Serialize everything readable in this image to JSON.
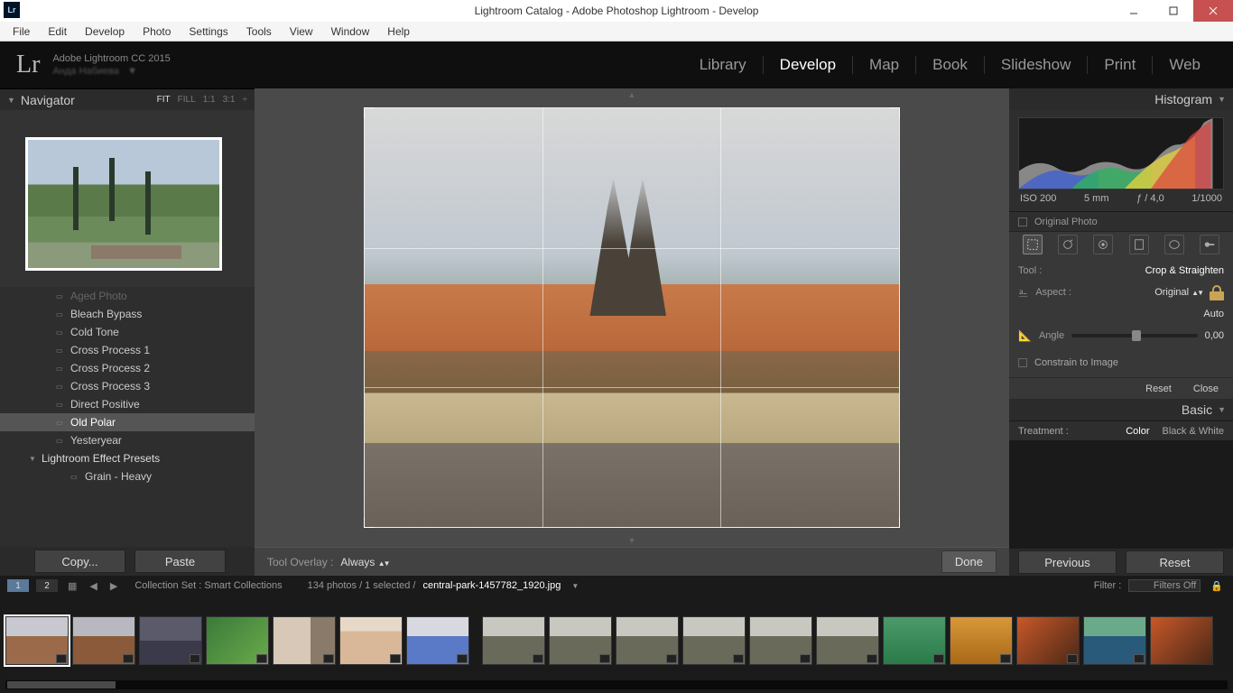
{
  "titlebar": {
    "title": "Lightroom Catalog - Adobe Photoshop Lightroom - Develop"
  },
  "menu": {
    "items": [
      "File",
      "Edit",
      "Develop",
      "Photo",
      "Settings",
      "Tools",
      "View",
      "Window",
      "Help"
    ]
  },
  "identity": {
    "logo": "Lr",
    "product": "Adobe Lightroom CC 2015"
  },
  "modules": {
    "items": [
      "Library",
      "Develop",
      "Map",
      "Book",
      "Slideshow",
      "Print",
      "Web"
    ],
    "active": "Develop"
  },
  "navigator": {
    "title": "Navigator",
    "zoom": [
      "FIT",
      "FILL",
      "1:1",
      "3:1"
    ]
  },
  "presets": {
    "items": [
      "Aged Photo",
      "Bleach Bypass",
      "Cold Tone",
      "Cross Process 1",
      "Cross Process 2",
      "Cross Process 3",
      "Direct Positive",
      "Old Polar",
      "Yesteryear"
    ],
    "selected": "Old Polar",
    "header": "Lightroom Effect Presets",
    "sub": "Grain - Heavy"
  },
  "leftbtns": {
    "copy": "Copy...",
    "paste": "Paste"
  },
  "centerbar": {
    "overlay_label": "Tool Overlay :",
    "overlay_value": "Always",
    "done": "Done"
  },
  "histogram": {
    "title": "Histogram",
    "iso": "ISO 200",
    "focal": "5 mm",
    "aperture": "ƒ / 4,0",
    "shutter": "1/1000",
    "original": "Original Photo"
  },
  "tool": {
    "label": "Tool :",
    "name": "Crop & Straighten",
    "aspect_l": "Aspect :",
    "aspect_v": "Original",
    "angle_l": "Angle",
    "angle_v": "0,00",
    "auto": "Auto",
    "constrain": "Constrain to Image",
    "reset": "Reset",
    "close": "Close"
  },
  "basic": {
    "title": "Basic",
    "treat_l": "Treatment :",
    "color": "Color",
    "bw": "Black & White"
  },
  "rightbtns": {
    "prev": "Previous",
    "reset": "Reset"
  },
  "pathbar": {
    "sw1": "1",
    "sw2": "2",
    "collection": "Collection Set : Smart Collections",
    "count": "134 photos / 1 selected /",
    "file": "central-park-1457782_1920.jpg",
    "filter_l": "Filter :",
    "filter_v": "Filters Off"
  }
}
